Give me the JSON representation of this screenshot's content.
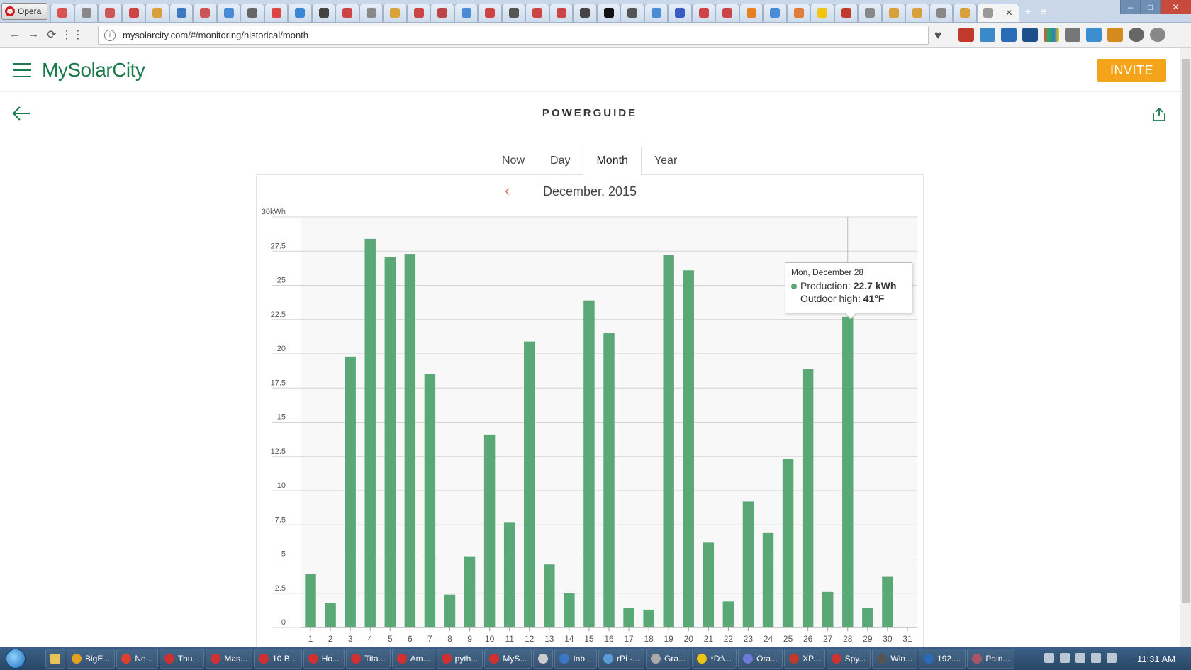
{
  "browser": {
    "opera_label": "Opera",
    "url": "mysolarcity.com/#/monitoring/historical/month",
    "tab_count": 42
  },
  "app": {
    "logo": "MySolarCity",
    "invite_label": "INVITE",
    "brand_color": "#1a7a4c",
    "invite_color": "#f4a41a"
  },
  "page": {
    "title": "POWERGUIDE",
    "tabs": [
      {
        "label": "Now",
        "active": false
      },
      {
        "label": "Day",
        "active": false
      },
      {
        "label": "Month",
        "active": true
      },
      {
        "label": "Year",
        "active": false
      }
    ],
    "month_label": "December, 2015"
  },
  "tooltip": {
    "date": "Mon, December 28",
    "production_label": "Production:",
    "production_value": "22.7 kWh",
    "temp_label": "Outdoor high:",
    "temp_value": "41°F"
  },
  "chart_data": {
    "type": "bar",
    "title": "",
    "categories": [
      "1",
      "2",
      "3",
      "4",
      "5",
      "6",
      "7",
      "8",
      "9",
      "10",
      "11",
      "12",
      "13",
      "14",
      "15",
      "16",
      "17",
      "18",
      "19",
      "20",
      "21",
      "22",
      "23",
      "24",
      "25",
      "26",
      "27",
      "28",
      "29",
      "30",
      "31"
    ],
    "values": [
      3.9,
      1.8,
      19.8,
      28.4,
      27.1,
      27.3,
      18.5,
      2.4,
      5.2,
      14.1,
      7.7,
      20.9,
      4.6,
      2.5,
      23.9,
      21.5,
      1.4,
      1.3,
      27.2,
      26.1,
      6.2,
      1.9,
      9.2,
      6.9,
      12.3,
      18.9,
      2.6,
      22.7,
      1.4,
      3.7,
      0
    ],
    "yticks": [
      "0",
      "2.5",
      "5",
      "7.5",
      "10",
      "12.5",
      "15",
      "17.5",
      "20",
      "22.5",
      "25",
      "27.5",
      "30kWh"
    ],
    "ylim": [
      0,
      30
    ],
    "bar_color": "#5aa876",
    "highlight_index": 27,
    "grid": true
  },
  "taskbar": {
    "items": [
      "BigE...",
      "Ne...",
      "Thu...",
      "Mas...",
      "10 B...",
      "Ho...",
      "Tita...",
      "Am...",
      "pyth...",
      "MyS...",
      "",
      "Inb...",
      "rPi -...",
      "Gra...",
      "*D:\\...",
      "Ora...",
      "XP...",
      "Spy...",
      "Win...",
      "192....",
      "Pain..."
    ],
    "clock": "11:31 AM"
  }
}
